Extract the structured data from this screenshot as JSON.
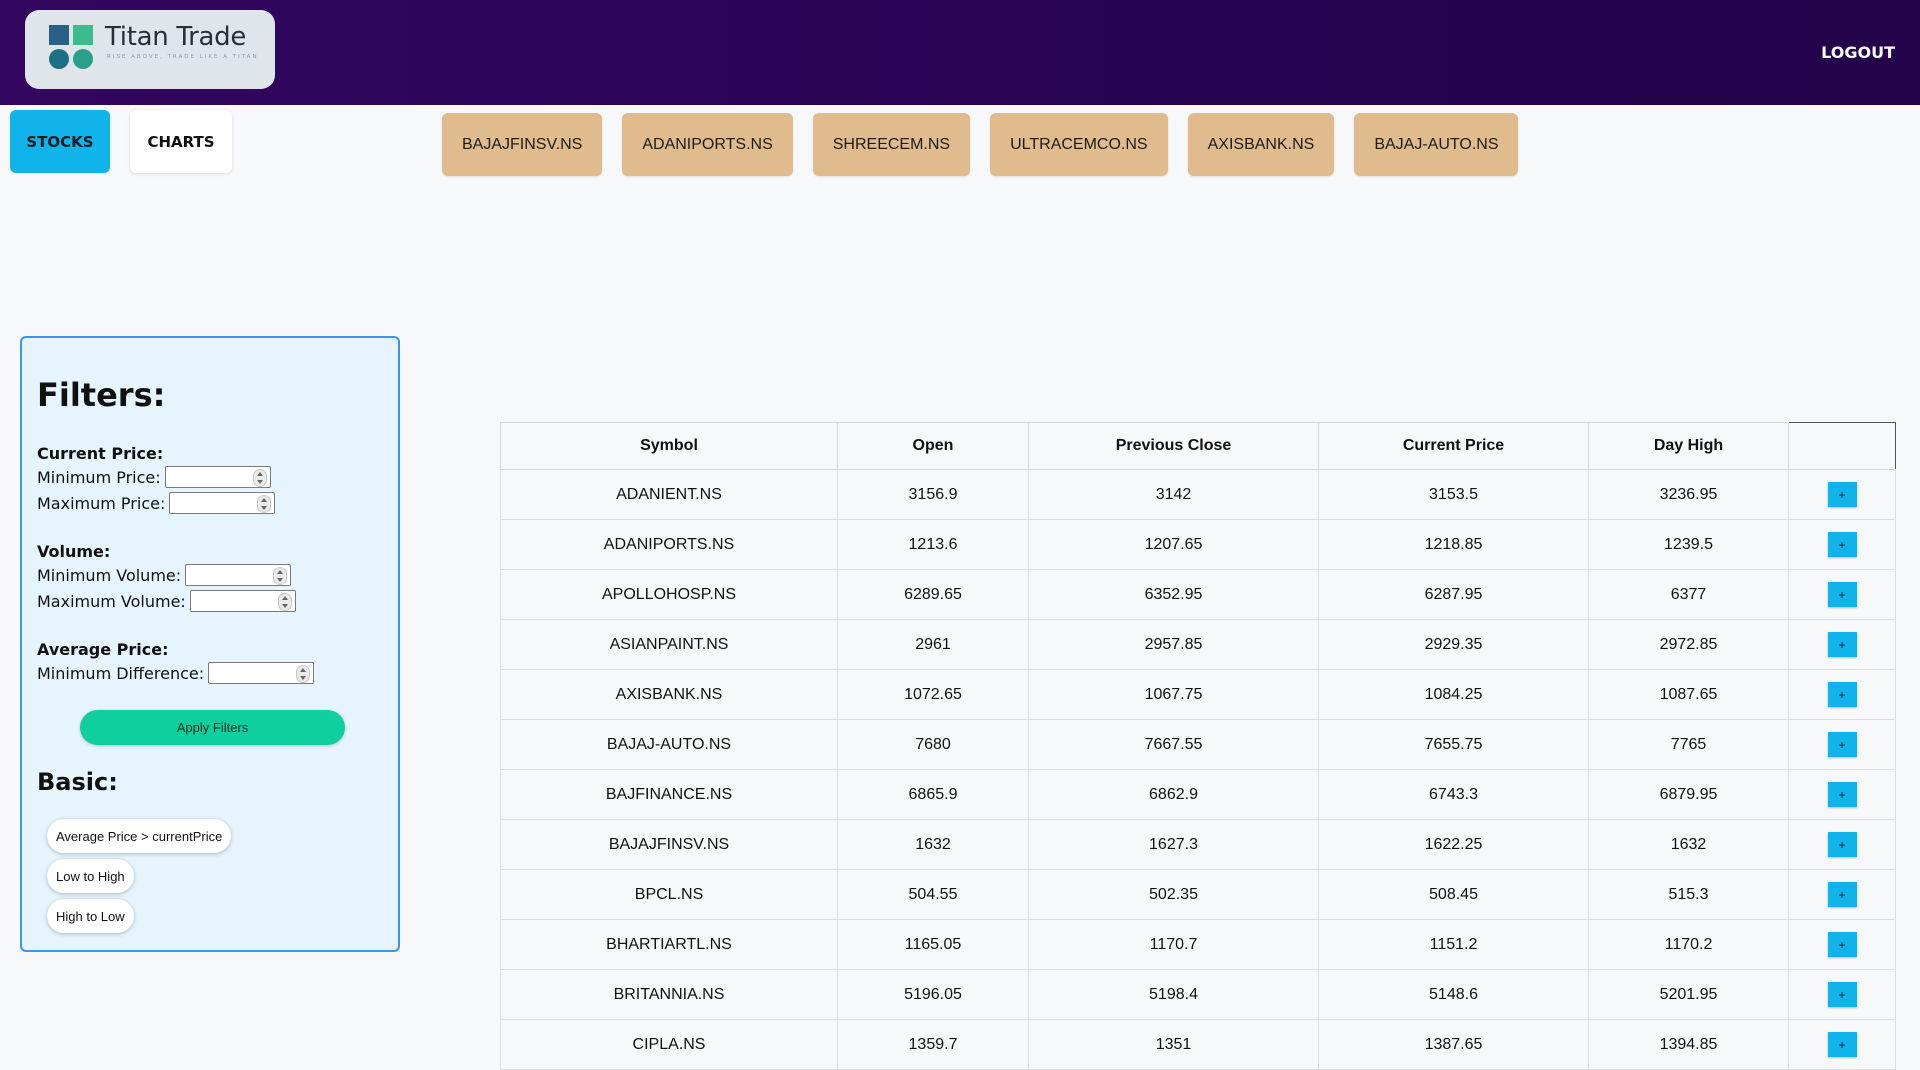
{
  "header": {
    "brand_name": "Titan Trade",
    "brand_tagline": "RISE ABOVE, TRADE LIKE A TITAN",
    "logout_label": "LOGOUT"
  },
  "nav": {
    "tabs": [
      {
        "label": "STOCKS",
        "active": true
      },
      {
        "label": "CHARTS",
        "active": false
      }
    ]
  },
  "tickers": [
    "BAJAJFINSV.NS",
    "ADANIPORTS.NS",
    "SHREECEM.NS",
    "ULTRACEMCO.NS",
    "AXISBANK.NS",
    "BAJAJ-AUTO.NS"
  ],
  "filters": {
    "title": "Filters:",
    "current_price": {
      "heading": "Current Price:",
      "min_label": "Minimum Price:",
      "max_label": "Maximum Price:"
    },
    "volume": {
      "heading": "Volume:",
      "min_label": "Minimum Volume:",
      "max_label": "Maximum Volume:"
    },
    "average_price": {
      "heading": "Average Price:",
      "min_diff_label": "Minimum Difference:"
    },
    "apply_label": "Apply Filters",
    "basic": {
      "title": "Basic:",
      "options": [
        "Average Price > currentPrice",
        "Low to High",
        "High to Low"
      ]
    }
  },
  "table": {
    "columns": [
      "Symbol",
      "Open",
      "Previous Close",
      "Current Price",
      "Day High",
      ""
    ],
    "add_label": "+",
    "rows": [
      [
        "ADANIENT.NS",
        "3156.9",
        "3142",
        "3153.5",
        "3236.95"
      ],
      [
        "ADANIPORTS.NS",
        "1213.6",
        "1207.65",
        "1218.85",
        "1239.5"
      ],
      [
        "APOLLOHOSP.NS",
        "6289.65",
        "6352.95",
        "6287.95",
        "6377"
      ],
      [
        "ASIANPAINT.NS",
        "2961",
        "2957.85",
        "2929.35",
        "2972.85"
      ],
      [
        "AXISBANK.NS",
        "1072.65",
        "1067.75",
        "1084.25",
        "1087.65"
      ],
      [
        "BAJAJ-AUTO.NS",
        "7680",
        "7667.55",
        "7655.75",
        "7765"
      ],
      [
        "BAJFINANCE.NS",
        "6865.9",
        "6862.9",
        "6743.3",
        "6879.95"
      ],
      [
        "BAJAJFINSV.NS",
        "1632",
        "1627.3",
        "1622.25",
        "1632"
      ],
      [
        "BPCL.NS",
        "504.55",
        "502.35",
        "508.45",
        "515.3"
      ],
      [
        "BHARTIARTL.NS",
        "1165.05",
        "1170.7",
        "1151.2",
        "1170.2"
      ],
      [
        "BRITANNIA.NS",
        "5196.05",
        "5198.4",
        "5148.6",
        "5201.95"
      ],
      [
        "CIPLA.NS",
        "1359.7",
        "1351",
        "1387.65",
        "1394.85"
      ]
    ]
  },
  "colors": {
    "header_bg": "#2a0355",
    "accent_blue": "#10b3ea",
    "chip_bg": "#dfbb8d",
    "apply_green": "#10cf9f",
    "filter_panel_bg": "#e6f4fd"
  }
}
